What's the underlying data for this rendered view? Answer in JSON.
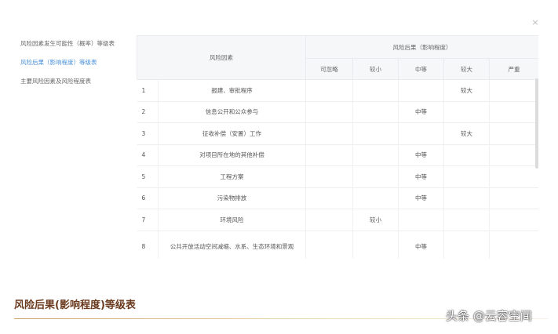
{
  "close": {
    "glyph": "×"
  },
  "sidebar": {
    "items": [
      {
        "label": "风险因素发生可能性（概率）等级表"
      },
      {
        "label": "风险后果（影响程度）等级表"
      },
      {
        "label": "主要风险因素及风险程度表"
      }
    ]
  },
  "table": {
    "headers": {
      "factor": "风险因素",
      "group": "风险后果（影响程度）",
      "levels": [
        "可忽略",
        "较小",
        "中等",
        "较大",
        "严重"
      ]
    },
    "rows": [
      {
        "no": "1",
        "factor": "报建、审批程序",
        "levels": [
          "",
          "",
          "",
          "较大",
          ""
        ]
      },
      {
        "no": "2",
        "factor": "信息公开和公众参与",
        "levels": [
          "",
          "",
          "中等",
          "",
          ""
        ]
      },
      {
        "no": "3",
        "factor": "征收补偿（安置）工作",
        "levels": [
          "",
          "",
          "",
          "较大",
          ""
        ]
      },
      {
        "no": "4",
        "factor": "对项目所在地的其他补偿",
        "levels": [
          "",
          "",
          "中等",
          "",
          ""
        ]
      },
      {
        "no": "5",
        "factor": "工程方案",
        "levels": [
          "",
          "",
          "中等",
          "",
          ""
        ]
      },
      {
        "no": "6",
        "factor": "污染物排放",
        "levels": [
          "",
          "",
          "中等",
          "",
          ""
        ]
      },
      {
        "no": "7",
        "factor": "环境风险",
        "levels": [
          "",
          "较小",
          "",
          "",
          ""
        ]
      },
      {
        "no": "8",
        "factor": "公共开放活动空间减缩、水系、生态环境和景观",
        "levels": [
          "",
          "",
          "中等",
          "",
          ""
        ]
      }
    ]
  },
  "section": {
    "title": "风险后果(影响程度)等级表"
  },
  "watermark": {
    "text": "头条 @云容空间"
  }
}
